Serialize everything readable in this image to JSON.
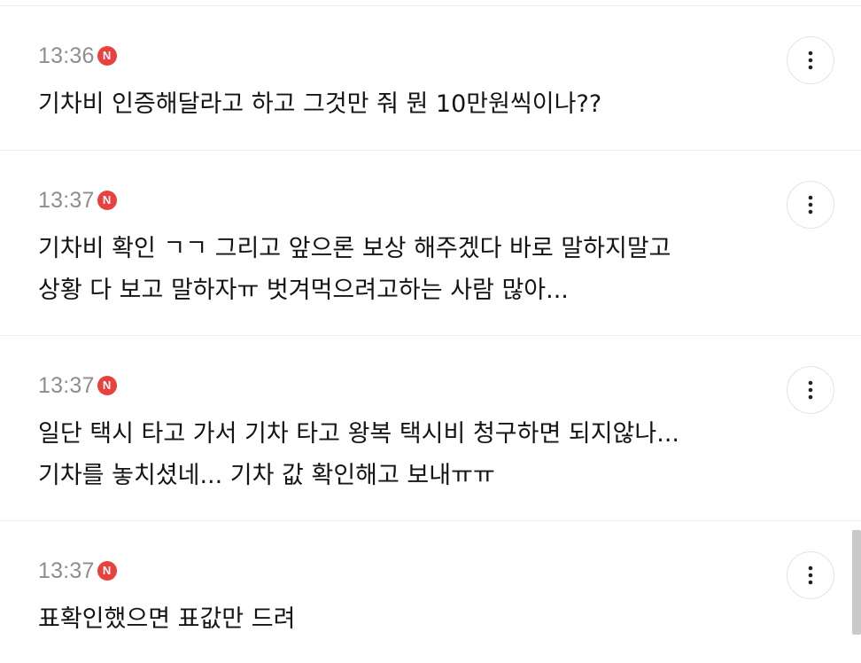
{
  "comments": [
    {
      "time": "13:36",
      "badge": "N",
      "text": "기차비 인증해달라고 하고 그것만 줘 뭔 10만원씩이나??"
    },
    {
      "time": "13:37",
      "badge": "N",
      "text": "기차비 확인 ㄱㄱ 그리고 앞으론 보상 해주겠다 바로 말하지말고\n상황 다 보고 말하자ㅠ 벗겨먹으려고하는 사람 많아..."
    },
    {
      "time": "13:37",
      "badge": "N",
      "text": "일단 택시 타고 가서 기차 타고 왕복 택시비 청구하면 되지않나...\n기차를 놓치셨네... 기차 값 확인해고 보내ㅠㅠ"
    },
    {
      "time": "13:37",
      "badge": "N",
      "text": "표확인했으면 표값만 드려"
    }
  ],
  "icons": {
    "new_badge": "new-badge-icon",
    "more": "more-vertical-icon"
  },
  "colors": {
    "new_badge": "#e8413e",
    "timestamp": "#8e8e8e",
    "divider": "#ececec"
  }
}
